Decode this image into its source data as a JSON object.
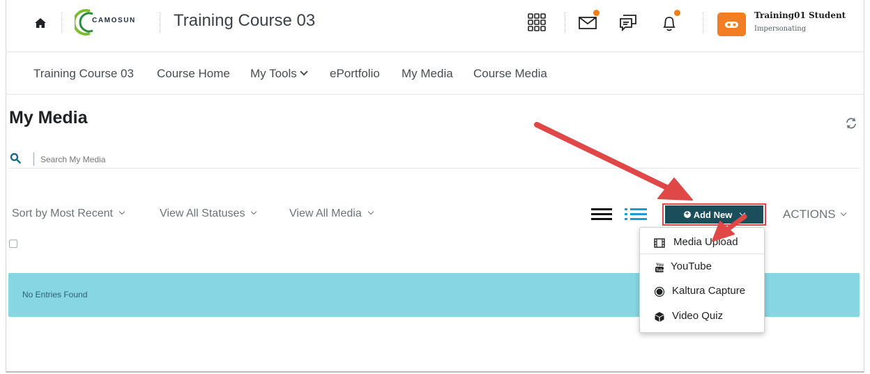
{
  "header": {
    "home_icon": "home-icon",
    "logo_text": "CAMOSUN",
    "course_title": "Training Course 03",
    "icons": [
      "apps-grid-icon",
      "mail-icon",
      "chat-icon",
      "bell-icon"
    ],
    "notification_color": "#f07d13",
    "user": {
      "name": "Training01 Student",
      "status": "Impersonating",
      "avatar_color": "#f27d22"
    }
  },
  "nav": {
    "items": [
      {
        "label": "Training Course 03"
      },
      {
        "label": "Course Home"
      },
      {
        "label": "My Tools",
        "has_dropdown": true
      },
      {
        "label": "ePortfolio"
      },
      {
        "label": "My Media"
      },
      {
        "label": "Course Media"
      }
    ]
  },
  "main": {
    "title": "My Media",
    "search": {
      "placeholder": "Search My Media",
      "value": ""
    },
    "filters": [
      {
        "label": "Sort by Most Recent"
      },
      {
        "label": "View All Statuses"
      },
      {
        "label": "View All Media"
      }
    ],
    "add_new_label": "Add New",
    "actions_label": "ACTIONS",
    "empty_message": "No Entries Found",
    "accent_color": "#194e5a",
    "banner_color": "#87d6e3"
  },
  "add_new_menu": {
    "items": [
      {
        "label": "Media Upload",
        "icon": "film-icon"
      },
      {
        "label": "YouTube",
        "icon": "youtube-icon"
      },
      {
        "label": "Kaltura Capture",
        "icon": "record-icon"
      },
      {
        "label": "Video Quiz",
        "icon": "cube-icon"
      }
    ]
  },
  "annotation": {
    "arrow_color": "#e04848"
  }
}
